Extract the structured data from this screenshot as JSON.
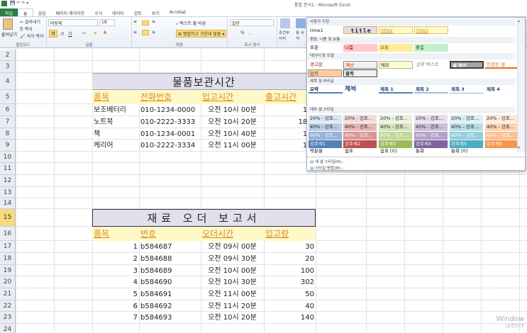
{
  "window": {
    "title": "통합 문서1 - Microsoft Excel"
  },
  "tabs": [
    "파일",
    "홈",
    "삽입",
    "페이지 레이아웃",
    "수식",
    "데이터",
    "검토",
    "보기",
    "Acrobat"
  ],
  "ribbon": {
    "clipboard": {
      "paste": "붙여넣기",
      "cut": "잘라내기",
      "copy": "복사",
      "format_painter": "서식 복사",
      "label": "클립보드"
    },
    "font": {
      "name": "바탕체",
      "size": "18",
      "label": "글꼴",
      "bold": "가",
      "italic": "가",
      "underline": "가"
    },
    "alignment": {
      "wrap": "텍스트 줄 바꿈",
      "merge": "병합하고 가운데 맞춤",
      "label": "맞춤"
    },
    "number": {
      "format": "일반",
      "percent": "%",
      "comma": ",",
      "label": "표시 형식"
    },
    "styles": {
      "conditional": "조건부 서식",
      "table": "표 서식"
    }
  },
  "sheet": {
    "row_numbers": [
      "2",
      "3",
      "4",
      "5",
      "6",
      "7",
      "8",
      "9",
      "10",
      "11",
      "12",
      "13",
      "14",
      "15",
      "16",
      "17",
      "18",
      "19",
      "20",
      "21",
      "22",
      "23",
      "24"
    ],
    "selected_row": "15",
    "table1": {
      "title": "물품보관시간",
      "headers": [
        "품목",
        "전화번호",
        "입고시간",
        "출고시간"
      ],
      "rows": [
        [
          "보조베터리",
          "010-1234-0000",
          "오전 10시 00분",
          "15:"
        ],
        [
          "노트북",
          "010-2222-3333",
          "오전 10시 20분",
          "18:0"
        ],
        [
          "책",
          "010-1234-0001",
          "오전 10시 40분",
          "13:"
        ],
        [
          "케리어",
          "010-2222-3334",
          "오전 11시 00분",
          "19:"
        ]
      ]
    },
    "table2": {
      "title": "재료 오더 보고서",
      "headers": [
        "품목",
        "번호",
        "오더시간",
        "입고량"
      ],
      "rows": [
        [
          "1",
          "b584687",
          "오전 09시 00분",
          "30"
        ],
        [
          "2",
          "b584688",
          "오전 09시 30분",
          "20"
        ],
        [
          "3",
          "b584689",
          "오전 10시 00분",
          "100"
        ],
        [
          "4",
          "b584690",
          "오전 10시 30분",
          "302"
        ],
        [
          "5",
          "b584691",
          "오전 11시 00분",
          "50"
        ],
        [
          "6",
          "b584692",
          "오전 11시 20분",
          "40"
        ],
        [
          "7",
          "b584693",
          "오전 10시 20분",
          "140"
        ]
      ]
    }
  },
  "gallery": {
    "sections": [
      "사용자 지정",
      "좋음, 나쁨 및 보통",
      "데이터 및 모델",
      "제목 및 머리글",
      "테마 셀 스타일",
      "숫자 서식"
    ],
    "custom": [
      "time1",
      "title",
      "title2",
      "title3"
    ],
    "goodbad": [
      "표준",
      "나쁨",
      "보통",
      "좋음"
    ],
    "data": [
      "경고문",
      "계산",
      "메모",
      "설명 텍스트",
      "셀 확인",
      "연결된 셀",
      "입력",
      "출력"
    ],
    "titles": [
      "요약",
      "제목",
      "제목 1",
      "제목 2",
      "제목 3",
      "제목 4"
    ],
    "theme_rows": [
      [
        "20% - 강조...",
        "20% - 강조...",
        "20% - 강조...",
        "20% - 강조...",
        "20% - 강조...",
        "20% - 강조..."
      ],
      [
        "40% - 강조...",
        "40% - 강조...",
        "40% - 강조...",
        "40% - 강조...",
        "40% - 강조...",
        "40% - 강조..."
      ],
      [
        "60% - 강조...",
        "60% - 강조...",
        "60% - 강조...",
        "60% - 강조...",
        "60% - 강조...",
        "60% - 강조..."
      ],
      [
        "강조색1",
        "강조색2",
        "강조색3",
        "강조색4",
        "강조색5",
        "강조색6"
      ]
    ],
    "number": [
      "백분율",
      "쉼표",
      "쉼표 [0]",
      "통화",
      "통화 [0]"
    ],
    "new_style": "새 셀 스타일(N)...",
    "merge_styles": "스타일 병합(M)...",
    "accent_colors": [
      "#4f81bd",
      "#c0504d",
      "#9bbb59",
      "#8064a2",
      "#4bacc6",
      "#f79646"
    ]
  },
  "watermark": {
    "line1": "Window",
    "line2": "[설정]으로"
  }
}
